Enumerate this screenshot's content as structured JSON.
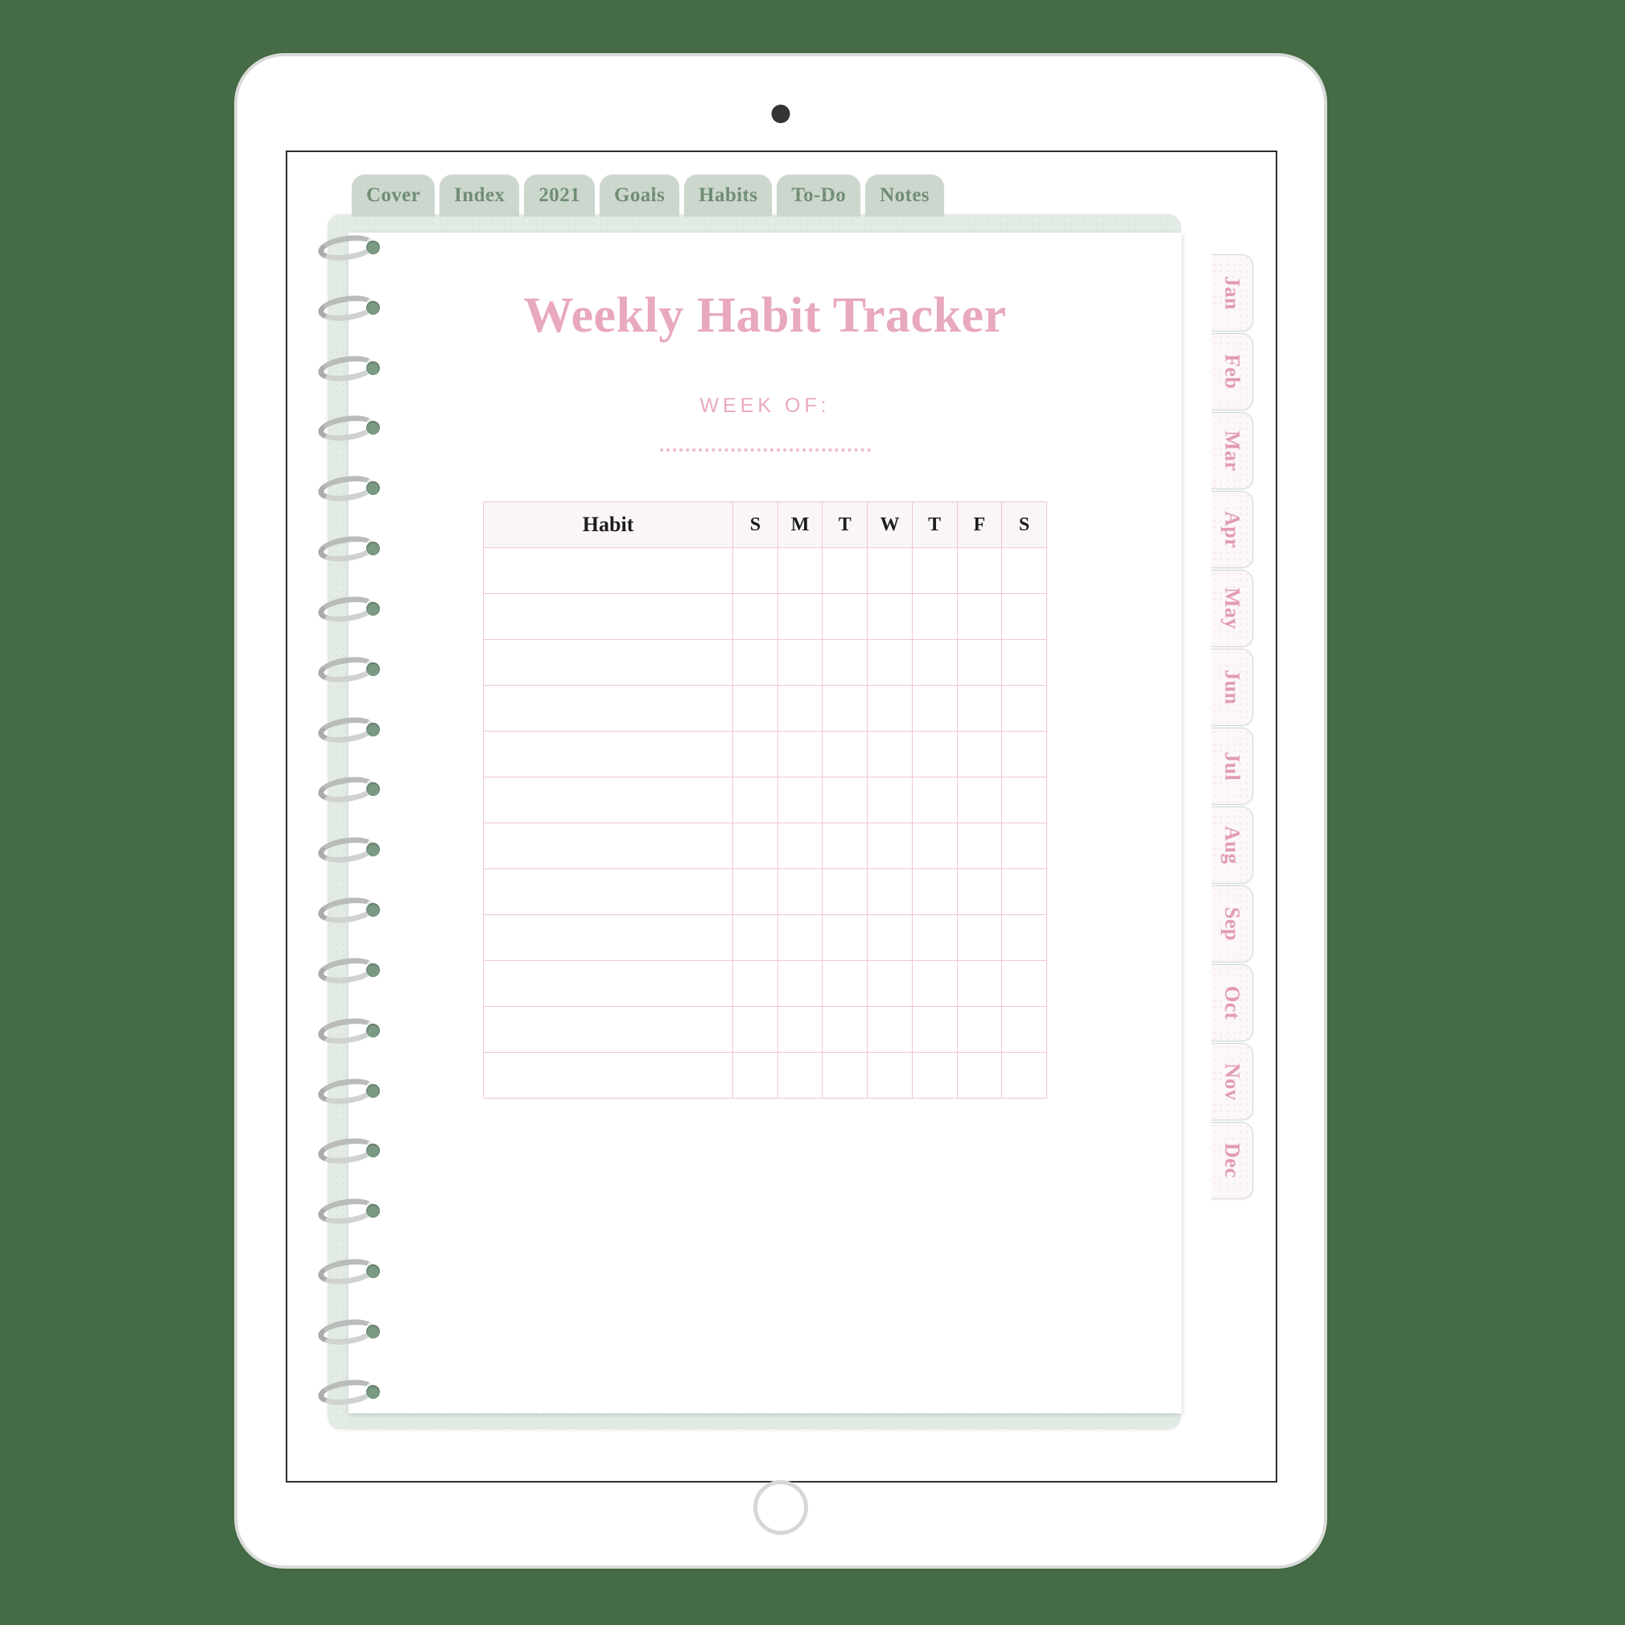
{
  "device": {
    "name": "tablet",
    "camera_icon": "camera-dot-icon",
    "home_button_icon": "home-button-icon",
    "frame_color": "#d9dcd9",
    "background_color": "#466b47"
  },
  "planner": {
    "cover_color": "#e3ebe5",
    "accent_pink": "#e8a8bd",
    "accent_green": "#6f8c74",
    "spiral": {
      "ring_count": 20,
      "icon": "spiral-ring-icon"
    },
    "top_tabs": [
      {
        "label": "Cover"
      },
      {
        "label": "Index"
      },
      {
        "label": "2021"
      },
      {
        "label": "Goals"
      },
      {
        "label": "Habits"
      },
      {
        "label": "To-Do"
      },
      {
        "label": "Notes"
      }
    ],
    "month_tabs": [
      {
        "label": "Jan"
      },
      {
        "label": "Feb"
      },
      {
        "label": "Mar"
      },
      {
        "label": "Apr"
      },
      {
        "label": "May"
      },
      {
        "label": "Jun"
      },
      {
        "label": "Jul"
      },
      {
        "label": "Aug"
      },
      {
        "label": "Sep"
      },
      {
        "label": "Oct"
      },
      {
        "label": "Nov"
      },
      {
        "label": "Dec"
      }
    ],
    "page": {
      "title": "Weekly Habit Tracker",
      "week_of_label": "WEEK OF:",
      "week_of_value": "",
      "table": {
        "headers": [
          "Habit",
          "S",
          "M",
          "T",
          "W",
          "T",
          "F",
          "S"
        ],
        "row_count": 12,
        "rows": [
          {
            "habit": "",
            "days": [
              "",
              "",
              "",
              "",
              "",
              "",
              ""
            ]
          },
          {
            "habit": "",
            "days": [
              "",
              "",
              "",
              "",
              "",
              "",
              ""
            ]
          },
          {
            "habit": "",
            "days": [
              "",
              "",
              "",
              "",
              "",
              "",
              ""
            ]
          },
          {
            "habit": "",
            "days": [
              "",
              "",
              "",
              "",
              "",
              "",
              ""
            ]
          },
          {
            "habit": "",
            "days": [
              "",
              "",
              "",
              "",
              "",
              "",
              ""
            ]
          },
          {
            "habit": "",
            "days": [
              "",
              "",
              "",
              "",
              "",
              "",
              ""
            ]
          },
          {
            "habit": "",
            "days": [
              "",
              "",
              "",
              "",
              "",
              "",
              ""
            ]
          },
          {
            "habit": "",
            "days": [
              "",
              "",
              "",
              "",
              "",
              "",
              ""
            ]
          },
          {
            "habit": "",
            "days": [
              "",
              "",
              "",
              "",
              "",
              "",
              ""
            ]
          },
          {
            "habit": "",
            "days": [
              "",
              "",
              "",
              "",
              "",
              "",
              ""
            ]
          },
          {
            "habit": "",
            "days": [
              "",
              "",
              "",
              "",
              "",
              "",
              ""
            ]
          },
          {
            "habit": "",
            "days": [
              "",
              "",
              "",
              "",
              "",
              "",
              ""
            ]
          }
        ]
      }
    }
  }
}
